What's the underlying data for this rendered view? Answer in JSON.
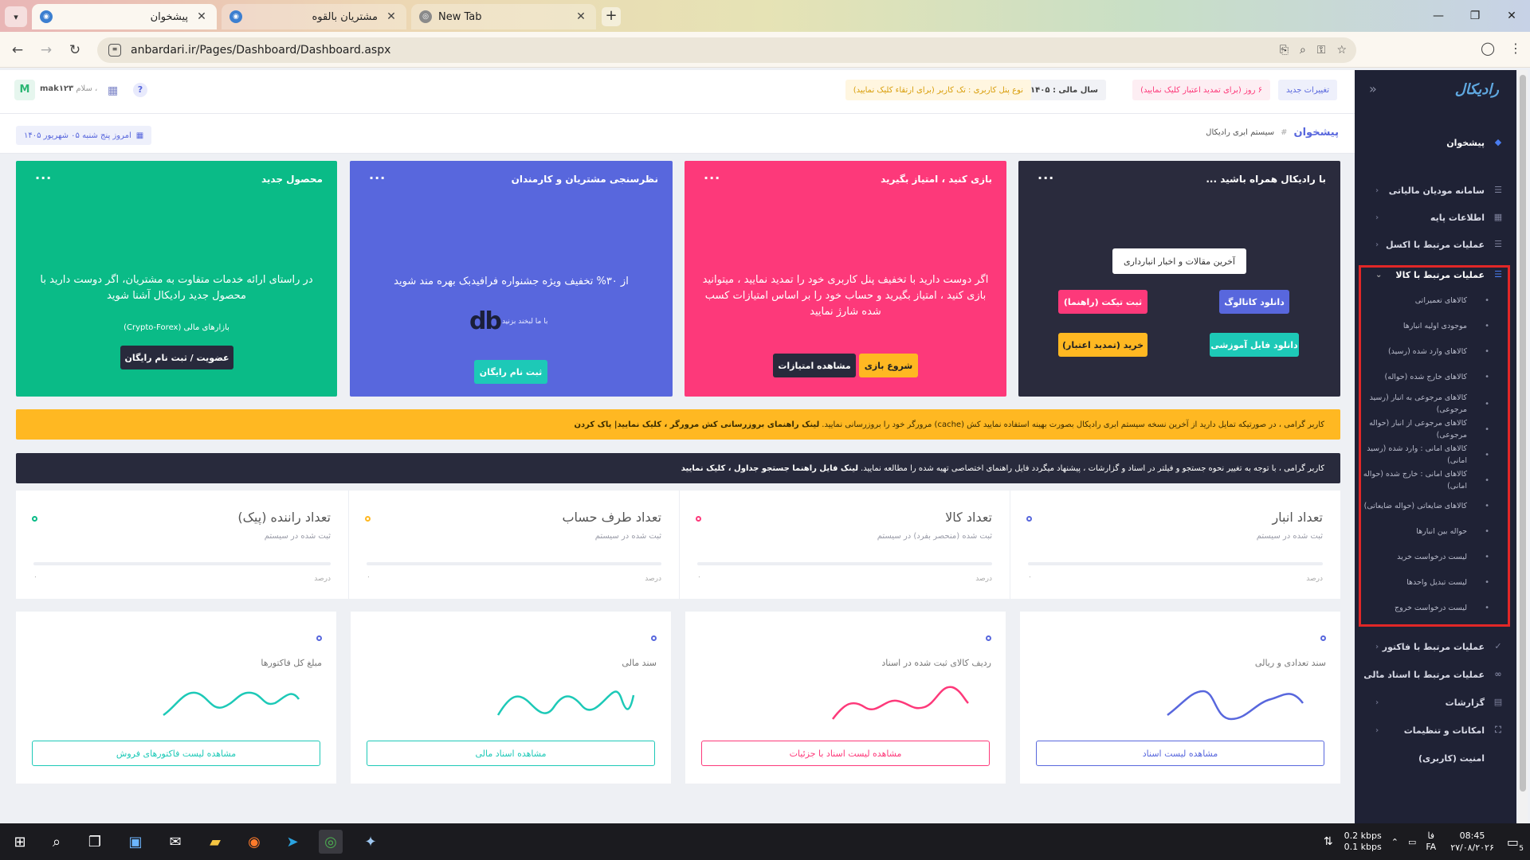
{
  "browser": {
    "tabs": [
      {
        "title": "پیشخوان",
        "active": true
      },
      {
        "title": "مشتریان بالقوه",
        "active": false
      },
      {
        "title": "New Tab",
        "active": false
      }
    ],
    "url": "anbardari.ir/Pages/Dashboard/Dashboard.aspx"
  },
  "header": {
    "badges": {
      "changes": "تغییرات جدید",
      "days_left": "۶ روز (برای تمدید اعتبار کلیک نمایید)",
      "fiscal_year": "سال مالی : ۱۴۰۵",
      "panel_type": "نوع پنل کاربری : تک کاربر (برای ارتقاء کلیک نمایید)"
    },
    "avatar_letter": "M",
    "greeting": "سلام ،",
    "username": "mak۱۲۳"
  },
  "subheader": {
    "page_title": "پیشخوان",
    "crumb_sep": "#",
    "crumb_text": "سیستم ابری رادیکال",
    "date": "امروز پنج شنبه ۰۵ شهریور ۱۴۰۵"
  },
  "cards": [
    {
      "title": "با رادیکال همراه باشید ...",
      "color": "#2a2b3d",
      "news_button": "آخرین مقالات و اخبار انبارداری",
      "buttons": [
        {
          "label": "دانلود کاتالوگ",
          "color": "#5867dd"
        },
        {
          "label": "ثبت تیکت (راهنما)",
          "color": "#fd397a"
        },
        {
          "label": "دانلود فایل آموزشی",
          "color": "#1dc9b7"
        },
        {
          "label": "خرید (تمدید اعتبار)",
          "color": "#ffb822"
        }
      ]
    },
    {
      "title": "بازی کنید ، امتیاز بگیرید",
      "color": "#fd397a",
      "body": "اگر دوست دارید با تخفیف پنل کاربری خود را تمدید نمایید ، میتوانید بازی کنید ، امتیاز بگیرید و حساب خود را بر اساس امتیازات کسب شده شارژ نمایید",
      "buttons": [
        {
          "label": "شروع بازی",
          "color": "#ffb822"
        },
        {
          "label": "مشاهده امتیازات",
          "color": "#282a3c"
        }
      ]
    },
    {
      "title": "نظرسنجی مشتریان و کارمندان",
      "color": "#5867dd",
      "body": "از ۳۰% تخفیف ویژه جشنواره فرافیدبک بهره مند شوید",
      "logo_text": "با ما لبخند بزنید",
      "buttons": [
        {
          "label": "ثبت نام رایگان",
          "color": "#1dc9b7"
        }
      ]
    },
    {
      "title": "محصول جدید",
      "color": "#0abb87",
      "body": "در راستای ارائه خدمات متفاوت به مشتریان، اگر دوست دارید با محصول جدید رادیکال آشنا شوید",
      "body2": "بازارهای مالی (Crypto-Forex)",
      "buttons": [
        {
          "label": "عضویت / ثبت نام رایگان",
          "color": "#282a3c"
        }
      ]
    }
  ],
  "notices": {
    "cache": "کاربر گرامی ، در صورتیکه تمایل دارید از آخرین نسخه سیستم ابری رادیکال بصورت بهینه استفاده نمایید کش (cache) مرورگر خود را بروزرسانی نمایید.",
    "cache_link": "لینک راهنمای بروزرسانی کش مرورگر ، کلیک نمایید| پاک کردن",
    "search": "کاربر گرامی ، با توجه به تغییر نحوه جستجو و فیلتر در اسناد و گزارشات ، پیشنهاد میگردد فایل راهنمای اختصاصی تهیه شده را مطالعه نمایید.",
    "search_link": "لینک فایل راهنما جستجو جداول ، کلیک نمایید"
  },
  "stats": [
    {
      "title": "تعداد انبار",
      "sub": "ثبت شده در سیستم",
      "color": "#5867dd",
      "pct_label": "درصد",
      "pct": "۰"
    },
    {
      "title": "تعداد کالا",
      "sub": "ثبت شده (منحصر بفرد) در سیستم",
      "color": "#fd397a",
      "pct_label": "درصد",
      "pct": "۰"
    },
    {
      "title": "تعداد طرف حساب",
      "sub": "ثبت شده در سیستم",
      "color": "#ffb822",
      "pct_label": "درصد",
      "pct": "۰"
    },
    {
      "title": "تعداد راننده (پیک)",
      "sub": "ثبت شده در سیستم",
      "color": "#0abb87",
      "pct_label": "درصد",
      "pct": "۰"
    }
  ],
  "chart_cards": [
    {
      "label": "سند تعدادی و ریالی",
      "color": "#5867dd",
      "button": "مشاهده لیست اسناد"
    },
    {
      "label": "ردیف کالای ثبت شده در اسناد",
      "color": "#fd397a",
      "button": "مشاهده لیست اسناد با جزئیات"
    },
    {
      "label": "سند مالی",
      "color": "#1dc9b7",
      "button": "مشاهده اسناد مالی"
    },
    {
      "label": "مبلغ کل فاکتورها",
      "color": "#1dc9b7",
      "button": "مشاهده لیست فاکتورهای فروش"
    }
  ],
  "sidebar": {
    "logo": "رادیکال",
    "home": "پیشخوان",
    "items_top": [
      "سامانه مودیان مالیاتی",
      "اطلاعات پایه",
      "عملیات مرتبط با اکسل"
    ],
    "open_section": "عملیات مرتبط با کالا",
    "sub_items": [
      "کالاهای تعمیراتی",
      "موجودی اولیه انبارها",
      "کالاهای وارد شده (رسید)",
      "کالاهای خارج شده (حواله)",
      "کالاهای مرجوعی به انبار (رسید مرجوعی)",
      "کالاهای مرجوعی از انبار (حواله مرجوعی)",
      "کالاهای امانی : وارد شده (رسید امانی)",
      "کالاهای امانی : خارج شده (حواله امانی)",
      "کالاهای ضایعاتی (حواله ضایعاتی)",
      "حواله بین انبارها",
      "لیست درخواست خرید",
      "لیست تبدیل واحدها",
      "لیست درخواست خروج"
    ],
    "items_bottom": [
      "عملیات مرتبط با فاکتور",
      "عملیات مرتبط با اسناد مالی",
      "گزارشات",
      "امکانات و تنظیمات",
      "امنیت (کاربری)"
    ]
  },
  "taskbar": {
    "net_down": "0.2 kbps",
    "net_up": "0.1 kbps",
    "lang": "فا",
    "lang2": "FA",
    "time": "08:45",
    "date": "۲۷/۰۸/۲۰۲۶",
    "notif_count": "5"
  }
}
